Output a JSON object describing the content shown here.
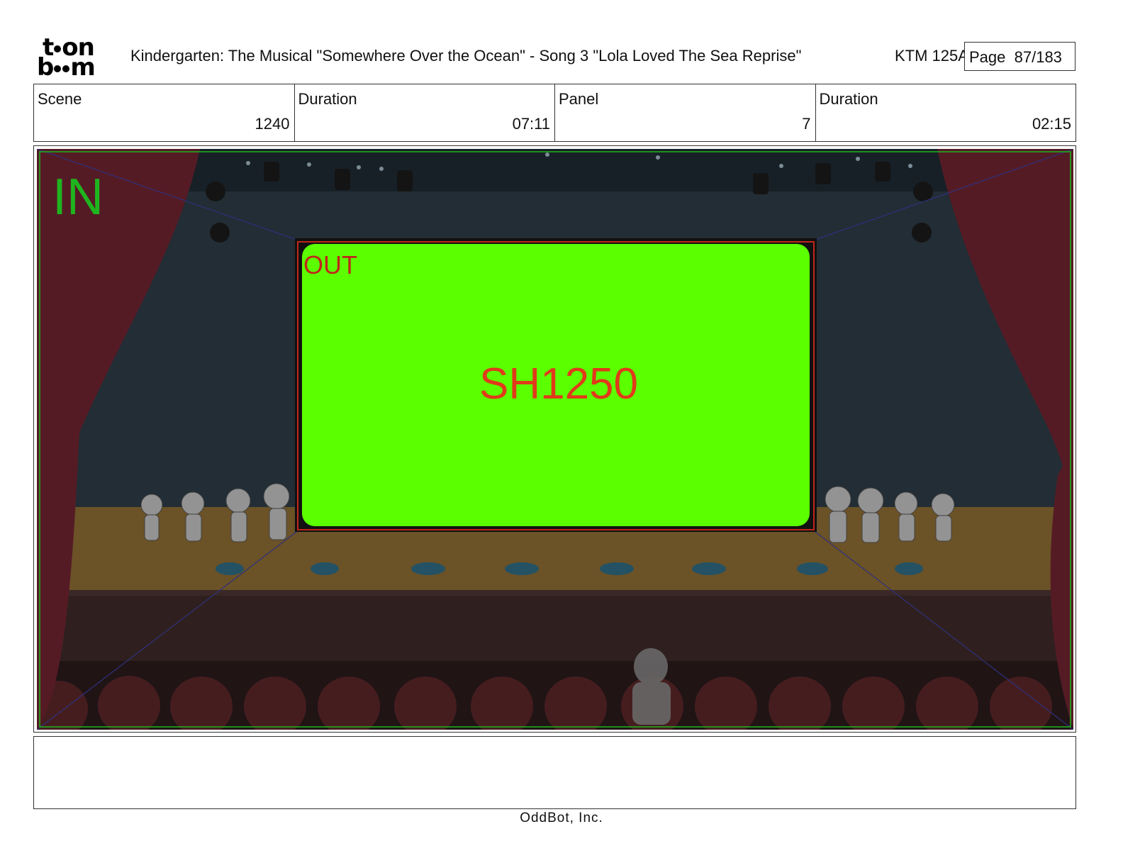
{
  "header": {
    "logo_top": "toon",
    "logo_bottom": "boom",
    "title": "Kindergarten: The Musical  \"Somewhere Over the Ocean\" - Song 3 \"Lola Loved The Sea Reprise\"",
    "code": "KTM 125A",
    "page_label": "Page",
    "page_value": "87/183"
  },
  "info": [
    {
      "label": "Scene",
      "value": "1240"
    },
    {
      "label": "Duration",
      "value": "07:11"
    },
    {
      "label": "Panel",
      "value": "7"
    },
    {
      "label": "Duration",
      "value": "02:15"
    }
  ],
  "panel": {
    "in_label": "IN",
    "out_label": "OUT",
    "shot_label": "SH1250",
    "colors": {
      "in_green": "#1fb51f",
      "screen_green": "#5bff00",
      "out_red": "#c0261a",
      "curtain": "#6e2330",
      "stage_floor": "#8a6a33",
      "backdrop": "#2c3a44"
    }
  },
  "footer": {
    "company": "OddBot, Inc."
  }
}
